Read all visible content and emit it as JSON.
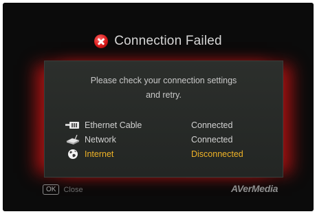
{
  "dialog": {
    "title": "Connection Failed",
    "title_icon": "error-x-icon",
    "message_line1": "Please check your connection settings",
    "message_line2": "and retry."
  },
  "status_items": [
    {
      "icon": "ethernet-cable-icon",
      "label": "Ethernet Cable",
      "value": "Connected"
    },
    {
      "icon": "network-router-icon",
      "label": "Network",
      "value": "Connected"
    },
    {
      "icon": "globe-icon",
      "label": "Internet",
      "value": "Disconnected"
    }
  ],
  "footer": {
    "ok_key": "OK",
    "close_label": "Close",
    "brand": "AVerMedia"
  },
  "colors": {
    "error": "#d81c1c",
    "disconnected": "#f0b427",
    "text": "#d2d2d2",
    "background": "#0b0b0b"
  }
}
